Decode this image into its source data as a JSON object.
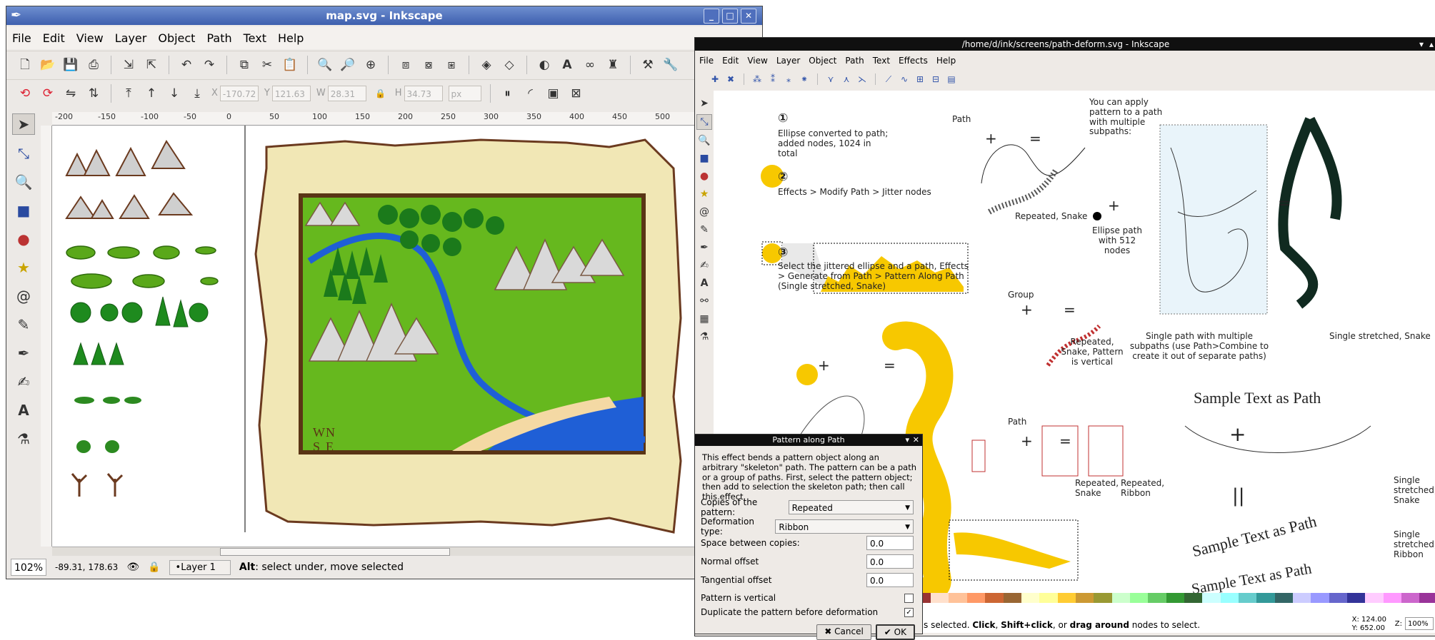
{
  "window1": {
    "title": "map.svg - Inkscape",
    "menu": [
      "File",
      "Edit",
      "View",
      "Layer",
      "Object",
      "Path",
      "Text",
      "Help"
    ],
    "fields": {
      "x_label": "X",
      "x_value": "-170.72",
      "y_label": "Y",
      "y_value": "121.63",
      "w_label": "W",
      "w_value": "28.31",
      "h_label": "H",
      "h_value": "34.73",
      "unit": "px"
    },
    "ruler_ticks": [
      "-200",
      "-150",
      "-100",
      "-50",
      "0",
      "50",
      "100",
      "150",
      "200",
      "250",
      "300",
      "350",
      "400",
      "450",
      "500"
    ],
    "status": {
      "zoom": "102%",
      "coords": "-89.31, 178.63",
      "layer": "•Layer 1",
      "message_bold": "Alt",
      "message": ": select under, move selected"
    }
  },
  "map_labels": {
    "compass_w": "W",
    "compass_n": "N",
    "compass_s": "S",
    "compass_e": "E"
  },
  "window2": {
    "title": "/home/d/ink/screens/path-deform.svg - Inkscape",
    "menu": [
      "File",
      "Edit",
      "View",
      "Layer",
      "Object",
      "Path",
      "Text",
      "Effects",
      "Help"
    ],
    "canvas": {
      "step1_num": "①",
      "step1_text": "Ellipse converted to path; added nodes, 1024 in total",
      "step2_num": "②",
      "step2_text": "Effects > Modify Path > Jitter nodes",
      "step3_num": "③",
      "step3_text": "Select the jittered ellipse and a path, Effects > Generate from Path > Pattern Along Path (Single stretched, Snake)",
      "path_label": "Path",
      "repeated_snake": "Repeated, Snake",
      "group_label": "Group",
      "repeated_snake_vertical": "Repeated, Snake, Pattern is vertical",
      "path_label2": "Path",
      "repeated_snake2": "Repeated, Snake",
      "repeated_ribbon": "Repeated, Ribbon",
      "apply_text": "You can apply pattern to a path with multiple subpaths:",
      "ellipse_text": "Ellipse path with 512 nodes",
      "single_path_text": "Single path with multiple subpaths (use Path>Combine to create it out of separate paths)",
      "single_stretched": "Single stretched, Snake",
      "sample_text": "Sample Text as Path",
      "plus": "+",
      "equals": "=",
      "double_bar": "||",
      "single_stretched_snake": "Single stretched, Snake",
      "single_stretched_ribbon": "Single stretched, Ribbon"
    },
    "status": {
      "text_pre": "s selected. ",
      "click": "Click",
      "comma1": ", ",
      "shift_click": "Shift+click",
      "or": ", or ",
      "drag_around": "drag around",
      "text_post": " nodes to select.",
      "x": "X: 124.00",
      "y": "Y: 652.00",
      "z_label": "Z:",
      "zoom": "100%"
    }
  },
  "dialog": {
    "title": "Pattern along Path",
    "description": "This effect bends a pattern object along an arbitrary \"skeleton\" path. The pattern can be a path or a group of paths. First, select the pattern object; then add to selection the skeleton path; then call this effect.",
    "copies_label": "Copies of the pattern:",
    "copies_value": "Repeated",
    "deform_label": "Deformation type:",
    "deform_value": "Ribbon",
    "space_label": "Space between copies:",
    "space_value": "0.0",
    "normal_label": "Normal offset",
    "normal_value": "0.0",
    "tangential_label": "Tangential offset",
    "tangential_value": "0.0",
    "vertical_label": "Pattern is vertical",
    "vertical_checked": false,
    "duplicate_label": "Duplicate the pattern before deformation",
    "duplicate_checked": true,
    "cancel_label": "Cancel",
    "ok_label": "OK"
  },
  "colors": {
    "accent_yellow": "#f7c800",
    "title_blue": "#4a6bb8",
    "map_green": "#66b81e",
    "river_blue": "#1f5fd6"
  }
}
